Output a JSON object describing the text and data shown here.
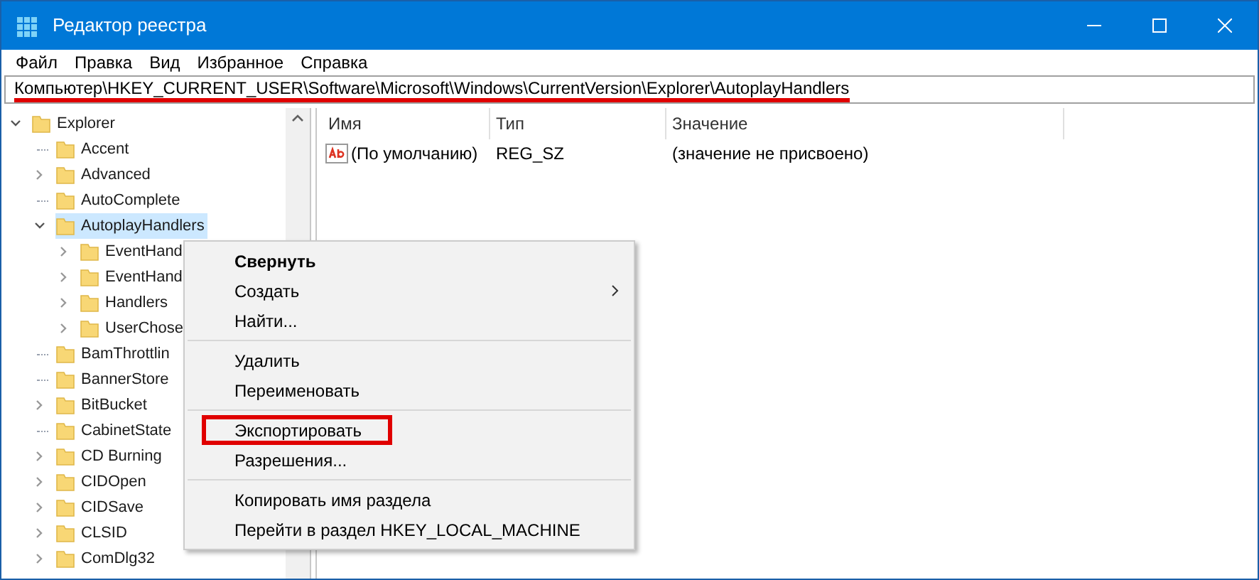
{
  "window": {
    "title": "Редактор реестра"
  },
  "menu_bar": [
    "Файл",
    "Правка",
    "Вид",
    "Избранное",
    "Справка"
  ],
  "address_bar": {
    "value": "Компьютер\\HKEY_CURRENT_USER\\Software\\Microsoft\\Windows\\CurrentVersion\\Explorer\\AutoplayHandlers",
    "underlined": true
  },
  "tree": [
    {
      "label": "Explorer",
      "kind": "branch",
      "expanded": true,
      "selected": false,
      "children": [
        {
          "label": "Accent",
          "kind": "leaf",
          "selected": false
        },
        {
          "label": "Advanced",
          "kind": "branch",
          "expanded": false,
          "selected": false
        },
        {
          "label": "AutoComplete",
          "kind": "leaf",
          "selected": false
        },
        {
          "label": "AutoplayHandlers",
          "kind": "branch",
          "expanded": true,
          "selected": true,
          "children": [
            {
              "label": "EventHand",
              "kind": "branch",
              "expanded": false,
              "selected": false
            },
            {
              "label": "EventHand",
              "kind": "branch",
              "expanded": false,
              "selected": false
            },
            {
              "label": "Handlers",
              "kind": "branch",
              "expanded": false,
              "selected": false
            },
            {
              "label": "UserChose",
              "kind": "branch",
              "expanded": false,
              "selected": false
            }
          ]
        },
        {
          "label": "BamThrottlin",
          "kind": "leaf",
          "selected": false
        },
        {
          "label": "BannerStore",
          "kind": "leaf",
          "selected": false
        },
        {
          "label": "BitBucket",
          "kind": "branch",
          "expanded": false,
          "selected": false
        },
        {
          "label": "CabinetState",
          "kind": "leaf",
          "selected": false
        },
        {
          "label": "CD Burning",
          "kind": "branch",
          "expanded": false,
          "selected": false
        },
        {
          "label": "CIDOpen",
          "kind": "branch",
          "expanded": false,
          "selected": false
        },
        {
          "label": "CIDSave",
          "kind": "branch",
          "expanded": false,
          "selected": false
        },
        {
          "label": "CLSID",
          "kind": "branch",
          "expanded": false,
          "selected": false
        },
        {
          "label": "ComDlg32",
          "kind": "branch",
          "expanded": false,
          "selected": false
        }
      ]
    }
  ],
  "values_table": {
    "columns": [
      "Имя",
      "Тип",
      "Значение"
    ],
    "rows": [
      {
        "name": "(По умолчанию)",
        "type": "REG_SZ",
        "value": "(значение не присвоено)"
      }
    ]
  },
  "context_menu": [
    {
      "kind": "item",
      "label": "Свернуть",
      "bold": true,
      "submenu": false,
      "highlighted": false
    },
    {
      "kind": "item",
      "label": "Создать",
      "bold": false,
      "submenu": true,
      "highlighted": false
    },
    {
      "kind": "item",
      "label": "Найти...",
      "bold": false,
      "submenu": false,
      "highlighted": false
    },
    {
      "kind": "separator"
    },
    {
      "kind": "item",
      "label": "Удалить",
      "bold": false,
      "submenu": false,
      "highlighted": false
    },
    {
      "kind": "item",
      "label": "Переименовать",
      "bold": false,
      "submenu": false,
      "highlighted": false
    },
    {
      "kind": "separator"
    },
    {
      "kind": "item",
      "label": "Экспортировать",
      "bold": false,
      "submenu": false,
      "highlighted": true
    },
    {
      "kind": "item",
      "label": "Разрешения...",
      "bold": false,
      "submenu": false,
      "highlighted": false
    },
    {
      "kind": "separator"
    },
    {
      "kind": "item",
      "label": "Копировать имя раздела",
      "bold": false,
      "submenu": false,
      "highlighted": false
    },
    {
      "kind": "item",
      "label": "Перейти в раздел HKEY_LOCAL_MACHINE",
      "bold": false,
      "submenu": false,
      "highlighted": false
    }
  ]
}
